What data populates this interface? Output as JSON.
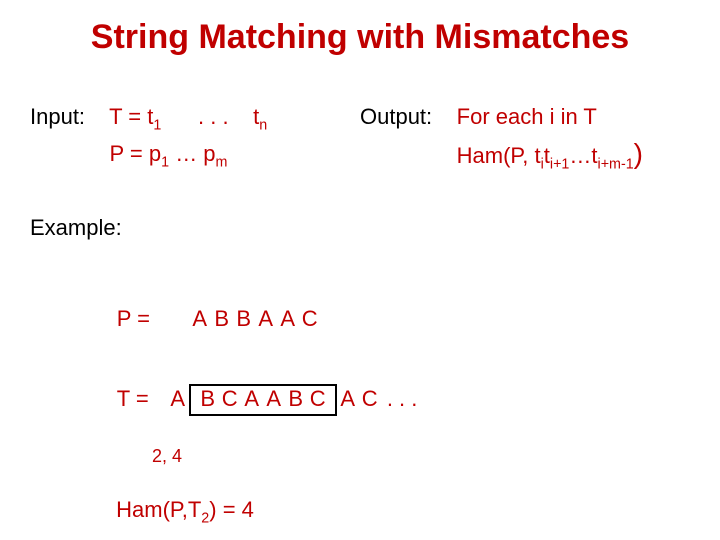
{
  "title": "String Matching with Mismatches",
  "input": {
    "label": "Input:",
    "t_pre": "T = t",
    "t_sub1": "1",
    "t_dots": ".  .  .",
    "t_end": "t",
    "t_subn": "n",
    "p_pre": "P = p",
    "p_sub1": "1",
    "p_dots": " … p",
    "p_subm": "m"
  },
  "output": {
    "label": "Output:",
    "line1": "For each i in T",
    "ham_pre": "Ham(P, t",
    "sub_i": "i",
    "mid1": "t",
    "sub_i1": "i+1",
    "dots": "…",
    "mid2": "t",
    "sub_im1": "i+m-1",
    "close": ")"
  },
  "example": {
    "label": "Example:",
    "p_label": "P = ",
    "t_label": "T = ",
    "p_cells": [
      "A",
      "B",
      "B",
      "A",
      "A",
      "C"
    ],
    "t_cells_pre": [
      "A"
    ],
    "t_cells_box": [
      "B",
      "C",
      "A",
      "A",
      "B",
      "C"
    ],
    "t_cells_post": [
      "A",
      "C"
    ],
    "t_trail": ". . .",
    "counts": "2, 4",
    "ham_result_pre": "Ham(P,T",
    "ham_result_sub": "2",
    "ham_result_mid": ")  =  ",
    "ham_result_val": "4"
  }
}
